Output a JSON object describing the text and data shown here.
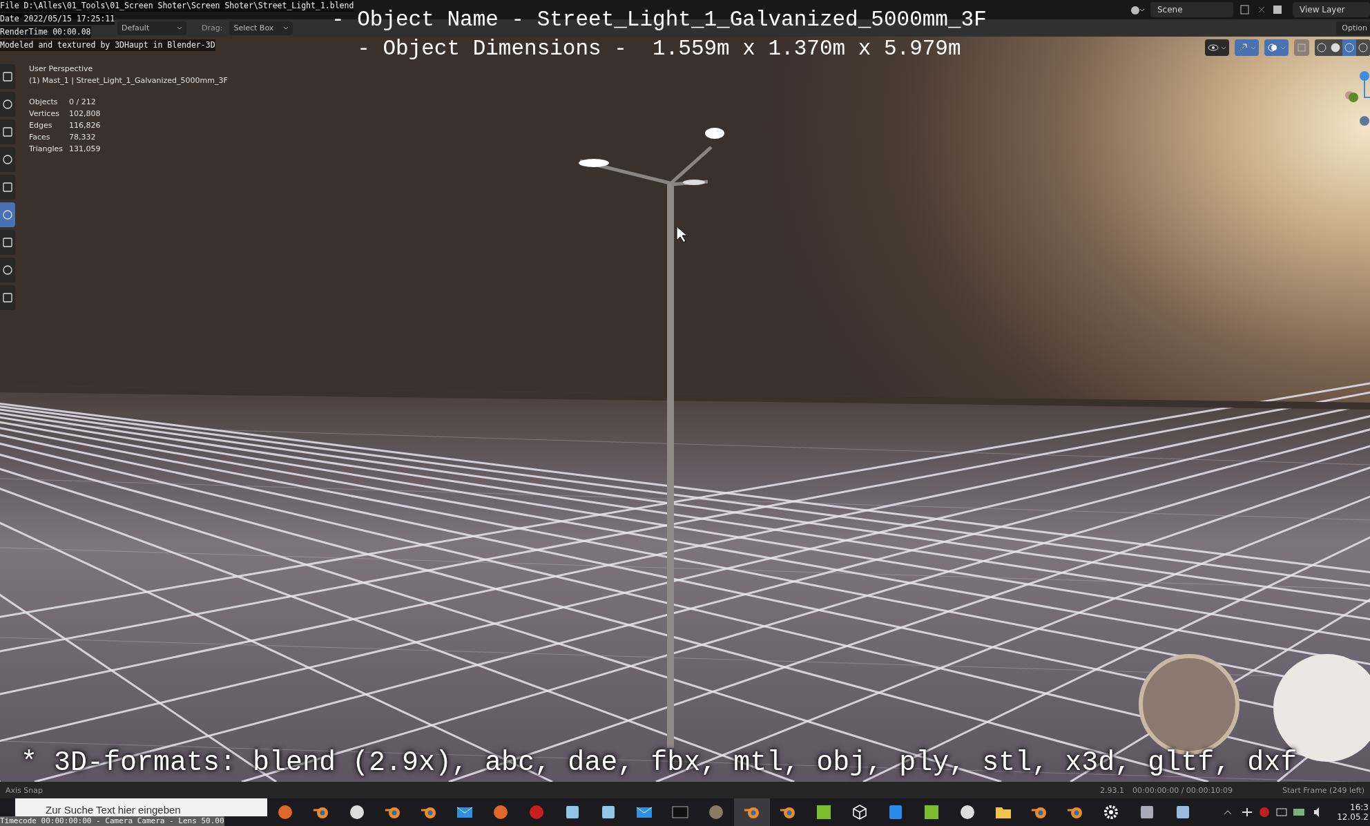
{
  "top_bar": {
    "scene": "Scene",
    "view_layer": "View Layer"
  },
  "tool_header": {
    "orientation_dropdown": "Default",
    "drag_label": "Drag:",
    "drag_dropdown": "Select Box",
    "options": "Option"
  },
  "toolbar": {
    "tools": [
      {
        "selected": false
      },
      {
        "selected": false
      },
      {
        "selected": false
      },
      {
        "selected": false
      },
      {
        "selected": false
      },
      {
        "selected": true
      },
      {
        "selected": false
      },
      {
        "selected": false
      },
      {
        "selected": false
      }
    ]
  },
  "viewport": {
    "view_name": "User Perspective",
    "object_info": "(1) Mast_1 | Street_Light_1_Galvanized_5000mm_3F",
    "stats": [
      {
        "label": "Objects",
        "value": "0 / 212"
      },
      {
        "label": "Vertices",
        "value": "102,808"
      },
      {
        "label": "Edges",
        "value": "116,826"
      },
      {
        "label": "Faces",
        "value": "78,332"
      },
      {
        "label": "Triangles",
        "value": "131,059"
      }
    ],
    "shading_modes": [
      {
        "selected": false
      },
      {
        "selected": false
      },
      {
        "selected": true
      },
      {
        "selected": false
      }
    ]
  },
  "stamp": {
    "top_lines": [
      "File D:\\Alles\\01_Tools\\01_Screen Shoter\\Screen Shoter\\Street_Light_1.blend",
      "Date 2022/05/15 17:25:11",
      "RenderTime 00:00.08",
      "Modeled and textured by 3DHaupt in Blender-3D"
    ],
    "bottom_line": "Timecode 00:00:00:00 - Camera Camera - Lens 50.00"
  },
  "captions": {
    "title_lines": [
      "- Object Name - Street_Light_1_Galvanized_5000mm_3F",
      "- Object Dimensions -  1.559m x 1.370m x 5.979m"
    ],
    "formats": "* 3D-formats: blend (2.9x), abc, dae, fbx, mtl, obj, ply, stl, x3d, gltf, dxf"
  },
  "status_bar": {
    "left": "Axis Snap",
    "version": "2.93.1",
    "timecode": "00:00:00:00 / 00:00:10:09",
    "frame_info": "Start Frame (249 left)"
  },
  "taskbar": {
    "search_placeholder": "Zur Suche Text hier eingeben",
    "time": "16:3",
    "date": "12.05.2"
  }
}
